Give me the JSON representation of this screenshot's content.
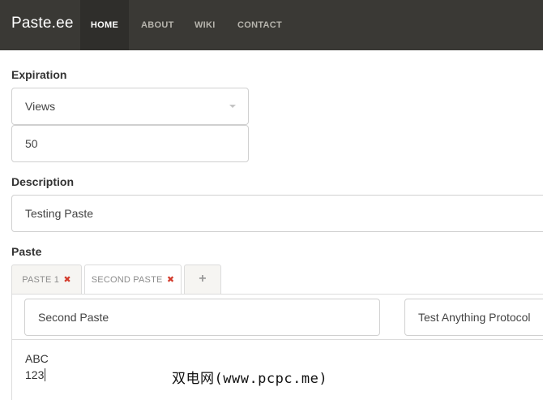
{
  "nav": {
    "brand": "Paste.ee",
    "items": [
      "HOME",
      "ABOUT",
      "WIKI",
      "CONTACT"
    ],
    "active": "HOME"
  },
  "expiration": {
    "label": "Expiration",
    "type_value": "Views",
    "count_value": "50"
  },
  "description": {
    "label": "Description",
    "value": "Testing Paste"
  },
  "paste": {
    "label": "Paste",
    "tabs": [
      {
        "label": "PASTE 1",
        "close": "✖"
      },
      {
        "label": "SECOND PASTE",
        "close": "✖"
      }
    ],
    "add_tab": "+",
    "active_tab": 1,
    "name_value": "Second Paste",
    "syntax_value": "Test Anything Protocol",
    "content_lines": [
      "ABC",
      "123"
    ]
  },
  "watermark": "双电网(www.pcpc.me)",
  "colors": {
    "navbar": "#3a3935",
    "navbar_active": "#2f2e2b",
    "tab_close": "#d33b2c"
  },
  "icons": {
    "dropdown": "caret-down-icon",
    "tab_close": "close-icon",
    "add_tab": "plus-icon"
  }
}
